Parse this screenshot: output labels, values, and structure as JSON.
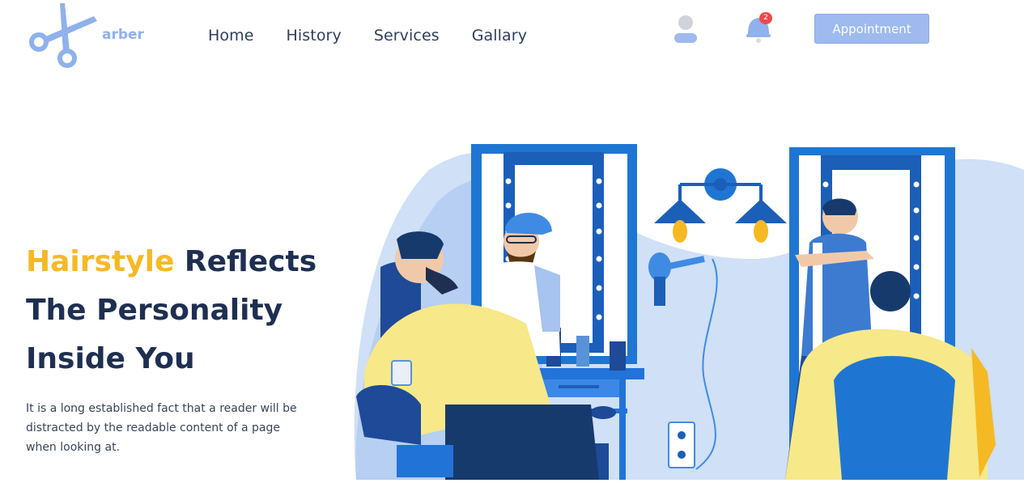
{
  "header": {
    "logo_text": "arber",
    "logo_icon": "scissors-icon",
    "nav": [
      "Home",
      "History",
      "Services",
      "Gallary"
    ],
    "notifications_count": "2",
    "appointment_label": "Appointment"
  },
  "hero": {
    "title_highlight": "Hairstyle",
    "title_rest_1": " Reflects",
    "title_line_2": "The Personality",
    "title_line_3": "Inside You",
    "description": "It is a long established fact that a reader will be distracted by the readable content of a page when looking at."
  },
  "colors": {
    "accent": "#9ebaee",
    "highlight": "#f5b924",
    "heading": "#1e2f52",
    "badge": "#ef4a4a"
  }
}
